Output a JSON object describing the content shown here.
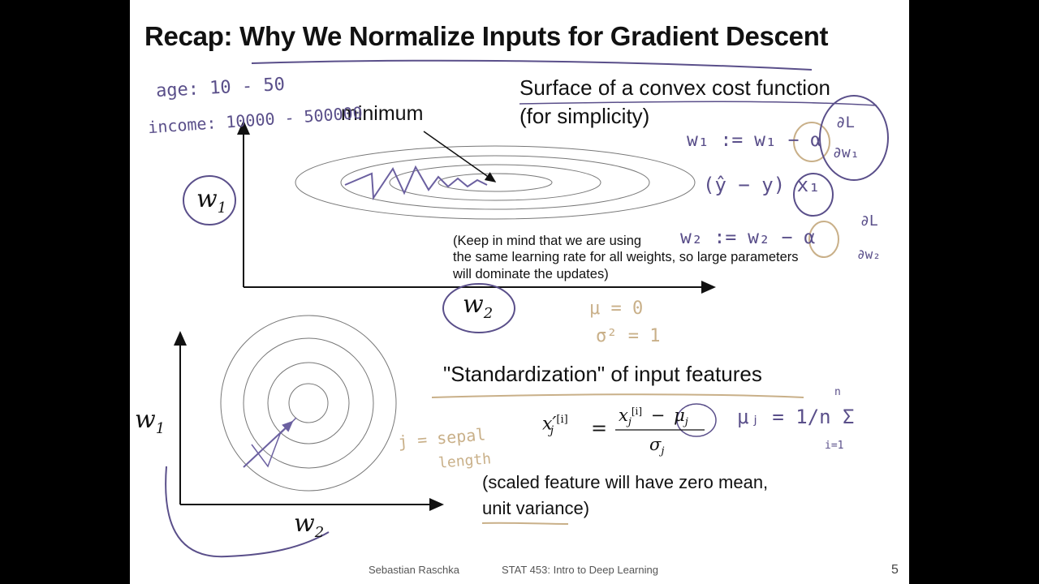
{
  "slide": {
    "title": "Recap: Why We Normalize Inputs for Gradient Descent",
    "page_number": "5",
    "footer": {
      "author": "Sebastian Raschka",
      "course": "STAT 453: Intro to Deep Learning"
    }
  },
  "top_section": {
    "surface_label_line1": "Surface of a convex cost function",
    "surface_label_line2": "(for simplicity)",
    "minimum_label": "minimum",
    "y_axis_label": "w",
    "y_axis_sub": "1",
    "x_axis_label": "w",
    "x_axis_sub": "2",
    "note_line1": "(Keep in mind that we are using",
    "note_line2": "the same learning rate for all weights, so large parameters",
    "note_line3": "will dominate the updates)"
  },
  "bottom_section": {
    "heading": "\"Standardization\" of input features",
    "y_axis_label": "w",
    "y_axis_sub": "1",
    "x_axis_label": "w",
    "x_axis_sub": "2",
    "formula": {
      "lhs": "x′",
      "lhs_sub": "j",
      "lhs_sup": "[i]",
      "equals": "=",
      "numerator": "x",
      "numerator_sub": "j",
      "numerator_sup": "[i]",
      "minus": "−",
      "mu": "μ",
      "mu_sub": "j",
      "denominator": "σ",
      "denominator_sub": "j"
    },
    "note_line1": "(scaled feature will have zero mean,",
    "note_line2": "unit variance)"
  },
  "handwriting": {
    "age": "age: 10 - 50",
    "income": "income: 10000 - 500000",
    "update_w1_a": "w₁ := w₁ − α",
    "update_w1_frac_num": "∂L",
    "update_w1_frac_den": "∂w₁",
    "update_mid": "(ŷ − y)  x₁",
    "update_w2_a": "w₂ := w₂ − α",
    "update_w2_frac_num": "∂L",
    "update_w2_frac_den": "∂w₂",
    "mu_sigma_1": "μ = 0",
    "mu_sigma_2": "σ² = 1",
    "j_note_1": "j = sepal",
    "j_note_2": "length",
    "mu_def": "μⱼ = 1/n Σ",
    "mu_def_top": "n",
    "mu_def_bottom": "i=1"
  },
  "colors": {
    "ink": "#5a4f8a",
    "ink_tan": "#c9b089",
    "text": "#111111"
  }
}
